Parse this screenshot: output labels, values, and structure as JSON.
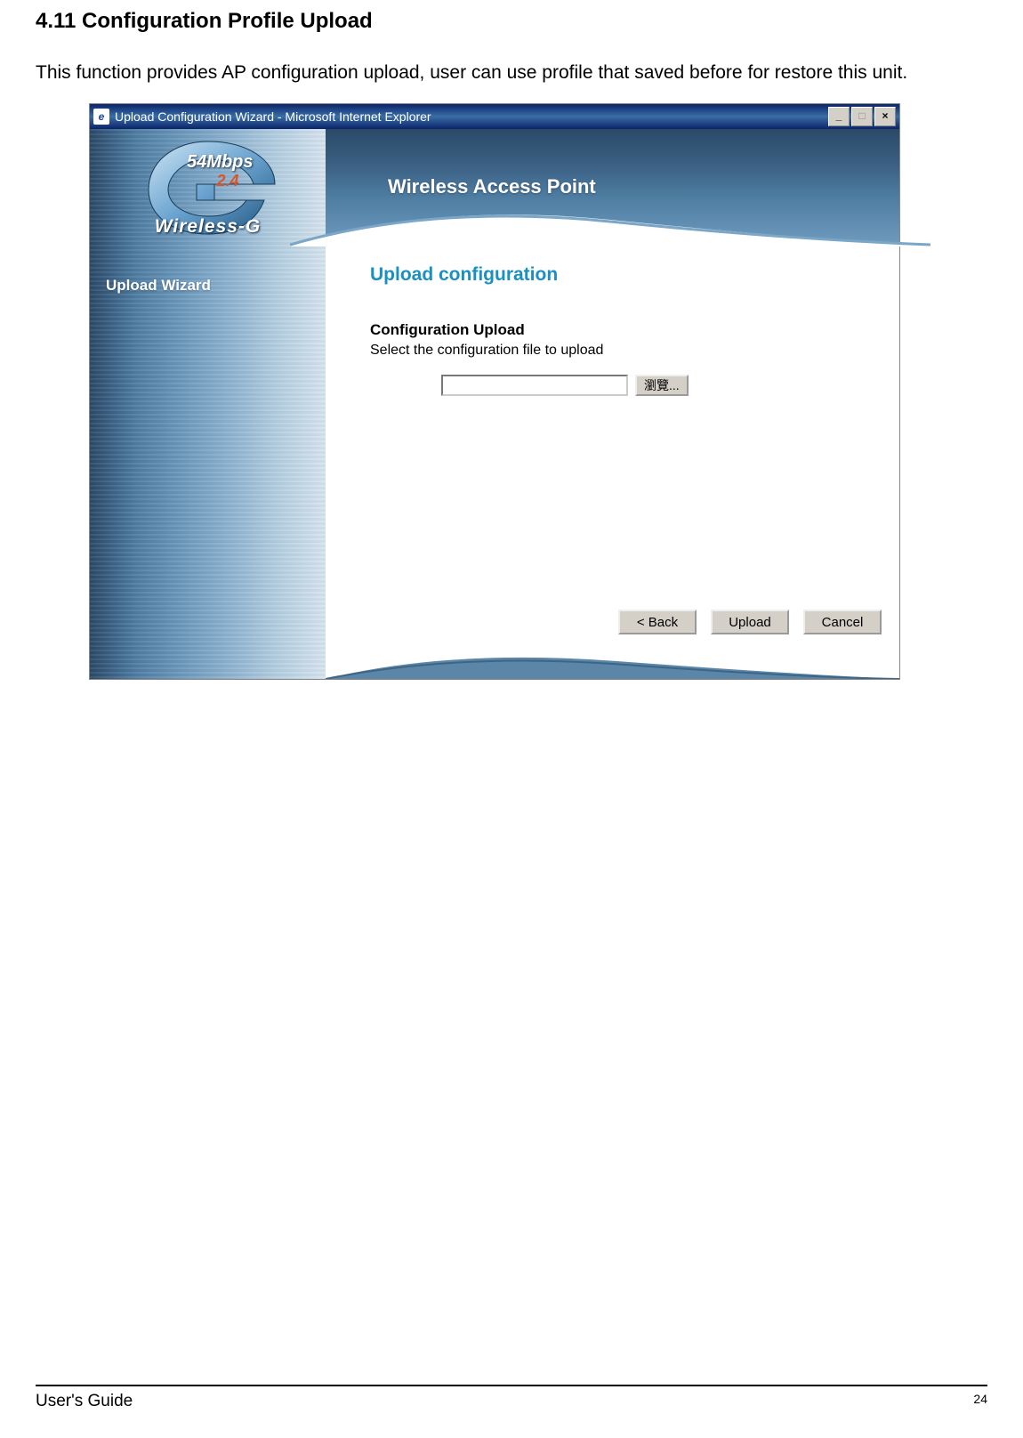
{
  "doc": {
    "section_title": "4.11 Configuration Profile Upload",
    "section_desc": "This function provides AP configuration upload, user can use profile that saved before for restore this unit.",
    "footer_left": "User's Guide",
    "footer_right": "24"
  },
  "window": {
    "title": "Upload Configuration Wizard - Microsoft Internet Explorer",
    "ie_icon_label": "e",
    "minimize": "_",
    "maximize": "□",
    "close": "×"
  },
  "logo": {
    "mbps": "54Mbps",
    "freq": "2.4",
    "brand": "Wireless-G"
  },
  "sidebar": {
    "items": [
      "Upload Wizard"
    ]
  },
  "banner": {
    "title": "Wireless Access Point"
  },
  "content": {
    "title": "Upload configuration",
    "form_heading": "Configuration Upload",
    "form_desc": "Select the configuration file to upload",
    "file_value": "",
    "browse_label": "瀏覽...",
    "buttons": {
      "back": "< Back",
      "upload": "Upload",
      "cancel": "Cancel"
    }
  }
}
